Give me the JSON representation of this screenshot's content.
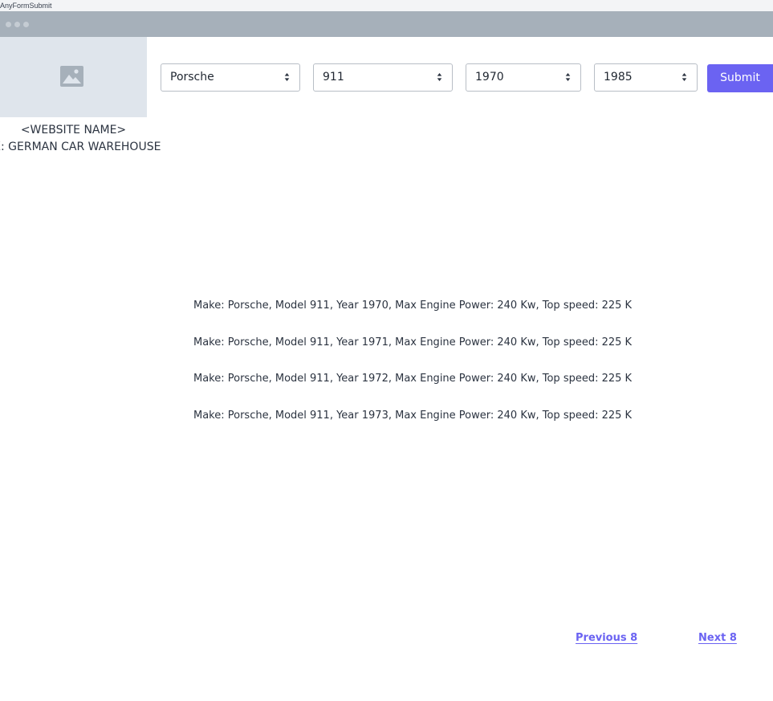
{
  "app": {
    "title": "AnyFormSubmit"
  },
  "header": {
    "site_name": "<WEBSITE NAME>",
    "site_example": "EX: GERMAN CAR WAREHOUSE"
  },
  "filters": {
    "make": "Porsche",
    "model": "911",
    "year_from": "1970",
    "year_to": "1985",
    "submit_label": "Submit"
  },
  "results": [
    "Make: Porsche, Model 911, Year 1970, Max Engine Power: 240 Kw, Top speed: 225 K",
    "Make: Porsche, Model 911, Year 1971, Max Engine Power: 240 Kw, Top speed: 225 K",
    "Make: Porsche, Model 911, Year 1972, Max Engine Power: 240 Kw, Top speed: 225 K",
    "Make: Porsche, Model 911, Year 1973, Max Engine Power: 240 Kw, Top speed: 225 K"
  ],
  "pagination": {
    "previous_label": "Previous 8",
    "next_label": "Next 8"
  },
  "colors": {
    "accent": "#6b63f2",
    "titlebar": "#a6b0ba",
    "logo_placeholder": "#dfe5ec"
  },
  "icons": {
    "logo": "image-placeholder-icon",
    "select_arrow": "updown-arrows-icon",
    "window_controls": "window-dot-icon"
  }
}
